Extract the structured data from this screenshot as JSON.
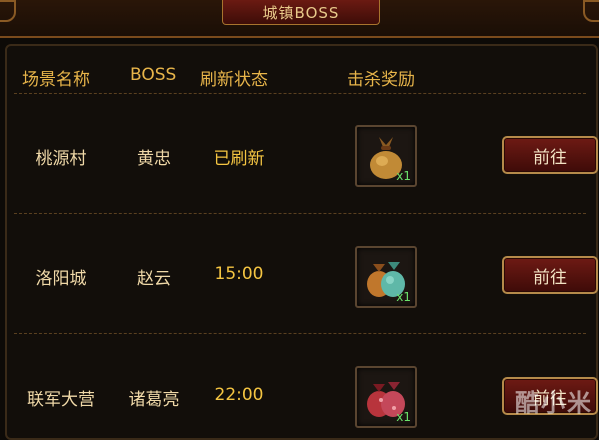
{
  "window": {
    "title": "城镇BOSS"
  },
  "table": {
    "headers": {
      "scene": "场景名称",
      "boss": "BOSS",
      "status": "刷新状态",
      "reward": "击杀奖励"
    },
    "rows": [
      {
        "scene": "桃源村",
        "boss": "黄忠",
        "status": "已刷新",
        "reward_qty": "x1",
        "reward_icon": "gold-bag-icon",
        "button": "前往"
      },
      {
        "scene": "洛阳城",
        "boss": "赵云",
        "status": "15:00",
        "reward_qty": "x1",
        "reward_icon": "orange-teal-bags-icon",
        "button": "前往"
      },
      {
        "scene": "联军大营",
        "boss": "诸葛亮",
        "status": "22:00",
        "reward_qty": "x1",
        "reward_icon": "red-bags-icon",
        "button": "前往"
      }
    ]
  },
  "watermark": "酷小米",
  "colors": {
    "header_text": "#e8b54a",
    "status_text": "#f5c542",
    "qty_text": "#6be36b",
    "button_bg": "#6e1a14"
  }
}
